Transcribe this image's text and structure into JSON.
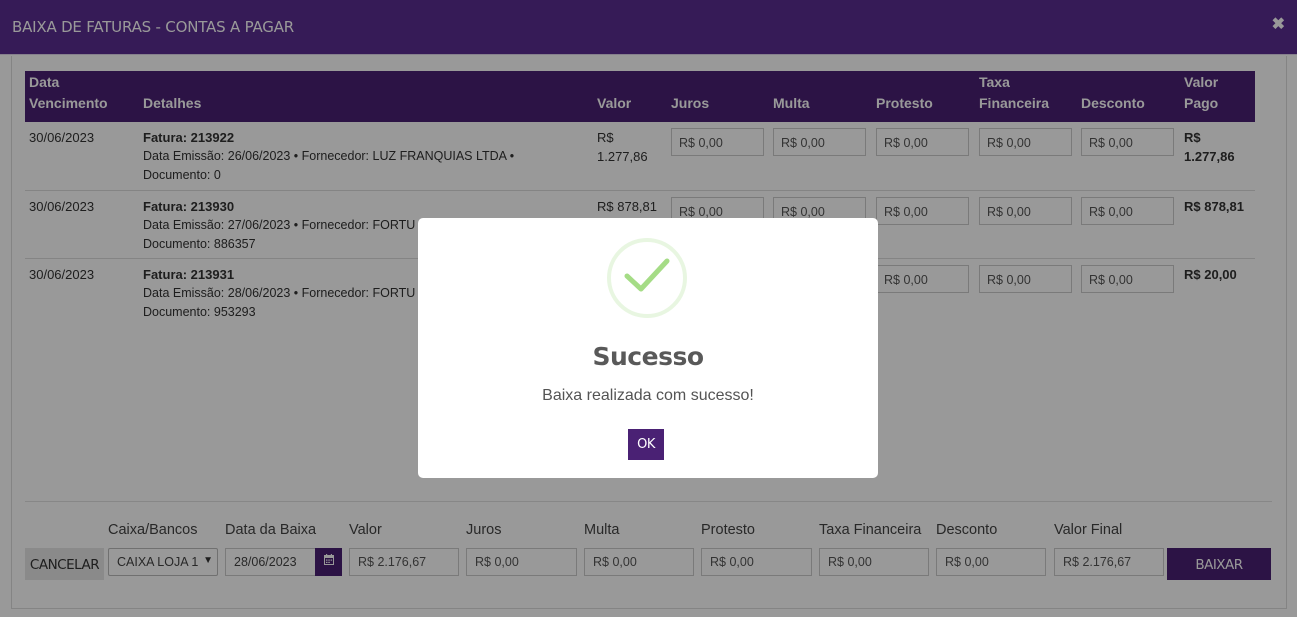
{
  "window": {
    "title": "BAIXA DE FATURAS - CONTAS A PAGAR",
    "close_glyph": "✖"
  },
  "table": {
    "headers": {
      "vencimento": "Data Vencimento",
      "detalhes": "Detalhes",
      "valor": "Valor",
      "juros": "Juros",
      "multa": "Multa",
      "protesto": "Protesto",
      "taxa": "Taxa Financeira",
      "desconto": "Desconto",
      "valor_pago": "Valor Pago"
    },
    "rows": [
      {
        "vencimento": "30/06/2023",
        "fatura": "Fatura: 213922",
        "info": "Data Emissão: 26/06/2023 • Fornecedor: LUZ FRANQUIAS LTDA •",
        "documento": "Documento: 0",
        "valor": "R$ 1.277,86",
        "juros": "R$ 0,00",
        "multa": "R$ 0,00",
        "protesto": "R$ 0,00",
        "taxa": "R$ 0,00",
        "desconto": "R$ 0,00",
        "valor_pago": "R$ 1.277,86"
      },
      {
        "vencimento": "30/06/2023",
        "fatura": "Fatura: 213930",
        "info": "Data Emissão: 27/06/2023 • Fornecedor: FORTU",
        "documento": "Documento: 886357",
        "valor": "R$ 878,81",
        "juros": "R$ 0,00",
        "multa": "R$ 0,00",
        "protesto": "R$ 0,00",
        "taxa": "R$ 0,00",
        "desconto": "R$ 0,00",
        "valor_pago": "R$ 878,81"
      },
      {
        "vencimento": "30/06/2023",
        "fatura": "Fatura: 213931",
        "info": "Data Emissão: 28/06/2023 • Fornecedor: FORTU",
        "documento": "Documento: 953293",
        "valor": "",
        "juros": "",
        "multa": "",
        "protesto": "R$ 0,00",
        "taxa": "R$ 0,00",
        "desconto": "R$ 0,00",
        "valor_pago": "R$ 20,00"
      }
    ]
  },
  "footer": {
    "labels": {
      "caixa": "Caixa/Bancos",
      "data": "Data da Baixa",
      "valor": "Valor",
      "juros": "Juros",
      "multa": "Multa",
      "protesto": "Protesto",
      "taxa": "Taxa Financeira",
      "desconto": "Desconto",
      "valor_final": "Valor Final"
    },
    "cancel_label": "CANCELAR",
    "caixa_value": "CAIXA LOJA 1",
    "data_value": "28/06/2023",
    "valor_value": "R$ 2.176,67",
    "juros_value": "R$ 0,00",
    "multa_value": "R$ 0,00",
    "protesto_value": "R$ 0,00",
    "taxa_value": "R$ 0,00",
    "desconto_value": "R$ 0,00",
    "valor_final_value": "R$ 2.176,67",
    "baixar_label": "BAIXAR"
  },
  "modal": {
    "title": "Sucesso",
    "message": "Baixa realizada com sucesso!",
    "ok_label": "OK",
    "icon": "success-check-icon"
  },
  "colors": {
    "header_purple": "#5b2d91",
    "accent_purple": "#4a2174",
    "success_green": "#a5dc86"
  }
}
